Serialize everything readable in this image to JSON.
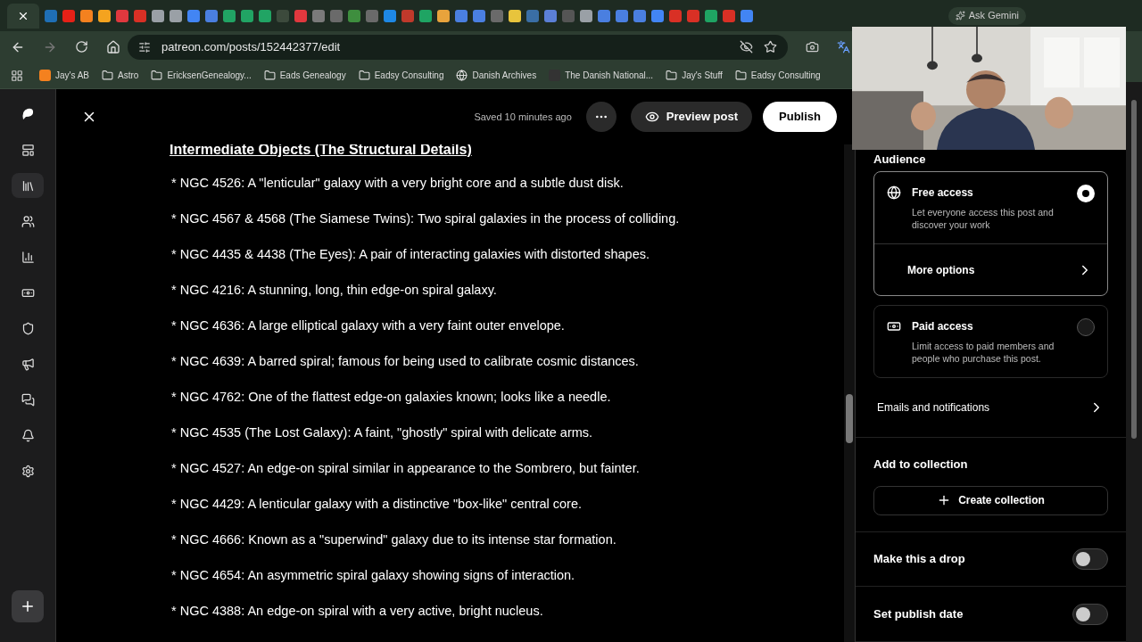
{
  "browser": {
    "tab_favicons": [
      {
        "color": "#1f6fb5"
      },
      {
        "color": "#e62117"
      },
      {
        "color": "#f4811f"
      },
      {
        "color": "#f4a31f"
      },
      {
        "color": "#e0383e"
      },
      {
        "color": "#d93025"
      },
      {
        "color": "#9aa0a6"
      },
      {
        "color": "#9aa0a6"
      },
      {
        "color": "#4285f4"
      },
      {
        "color": "#4a7fe0"
      },
      {
        "color": "#21a464"
      },
      {
        "color": "#21a464"
      },
      {
        "color": "#21a464"
      },
      {
        "color": "#3c4a3c"
      },
      {
        "color": "#e0383e"
      },
      {
        "color": "#7a7a7a"
      },
      {
        "color": "#6a6a6a"
      },
      {
        "color": "#3e8e3e"
      },
      {
        "color": "#6a6a6a"
      },
      {
        "color": "#1e88e5"
      },
      {
        "color": "#c0392b"
      },
      {
        "color": "#1fa463"
      },
      {
        "color": "#e8a33c"
      },
      {
        "color": "#4a7fe0"
      },
      {
        "color": "#4a7fe0"
      },
      {
        "color": "#6a6a6a"
      },
      {
        "color": "#e8c43c"
      },
      {
        "color": "#3a6ea5"
      },
      {
        "color": "#5b7fd6"
      },
      {
        "color": "#555555"
      },
      {
        "color": "#9aa0a6"
      },
      {
        "color": "#4a7fe0"
      },
      {
        "color": "#4a7fe0"
      },
      {
        "color": "#4a7fe0"
      },
      {
        "color": "#4285f4"
      },
      {
        "color": "#d93025"
      },
      {
        "color": "#d93025"
      },
      {
        "color": "#1fa463"
      },
      {
        "color": "#d93025"
      },
      {
        "color": "#4285f4"
      }
    ],
    "ask_label": "Ask Gemini",
    "url": "patreon.com/posts/152442377/edit",
    "bookmarks": [
      {
        "kind": "site",
        "label": "Jay's AB",
        "color": "#f4811f"
      },
      {
        "kind": "folder",
        "label": "Astro"
      },
      {
        "kind": "folder",
        "label": "EricksenGenealogy..."
      },
      {
        "kind": "folder",
        "label": "Eads Genealogy"
      },
      {
        "kind": "folder",
        "label": "Eadsy Consulting"
      },
      {
        "kind": "globe",
        "label": "Danish Archives"
      },
      {
        "kind": "site",
        "label": "The Danish National...",
        "color": "#333333"
      },
      {
        "kind": "folder",
        "label": "Jay's Stuff"
      },
      {
        "kind": "folder",
        "label": "Eadsy Consulting"
      }
    ]
  },
  "rail": {
    "items": [
      {
        "kind": "logo",
        "selected": false
      },
      {
        "kind": "layout",
        "selected": false
      },
      {
        "kind": "library",
        "selected": true
      },
      {
        "kind": "people",
        "selected": false
      },
      {
        "kind": "chart",
        "selected": false
      },
      {
        "kind": "money",
        "selected": false
      },
      {
        "kind": "shield",
        "selected": false
      },
      {
        "kind": "megaphone",
        "selected": false
      },
      {
        "kind": "chat",
        "selected": false
      },
      {
        "kind": "bell",
        "selected": false
      },
      {
        "kind": "gear",
        "selected": false
      }
    ]
  },
  "header": {
    "saved": "Saved 10 minutes ago",
    "preview": "Preview post",
    "publish": "Publish"
  },
  "editor": {
    "heading": "Intermediate Objects (The Structural Details)",
    "items": [
      "* NGC 4526: A \"lenticular\" galaxy with a very bright core and a subtle dust disk.",
      "* NGC 4567 & 4568 (The Siamese Twins): Two spiral galaxies in the process of colliding.",
      "* NGC 4435 & 4438 (The Eyes): A pair of interacting galaxies with distorted shapes.",
      "* NGC 4216: A stunning, long, thin edge-on spiral galaxy.",
      "* NGC 4636: A large elliptical galaxy with a very faint outer envelope.",
      "* NGC 4639: A barred spiral; famous for being used to calibrate cosmic distances.",
      "* NGC 4762: One of the flattest edge-on galaxies known; looks like a needle.",
      "* NGC 4535 (The Lost Galaxy): A faint, \"ghostly\" spiral with delicate arms.",
      "* NGC 4527: An edge-on spiral similar in appearance to the Sombrero, but fainter.",
      "* NGC 4429: A lenticular galaxy with a distinctive \"box-like\" central core.",
      "* NGC 4666: Known as a \"superwind\" galaxy due to its intense star formation.",
      "* NGC 4654: An asymmetric spiral galaxy showing signs of interaction.",
      "* NGC 4388: An edge-on spiral with a very active, bright nucleus."
    ]
  },
  "settings": {
    "audience_title": "Audience",
    "access_options": [
      {
        "kind": "globe",
        "title": "Free access",
        "description": "Let everyone access this post and discover your work",
        "selected": true
      },
      {
        "kind": "money",
        "title": "Paid access",
        "description": "Limit access to paid members and people who purchase this post.",
        "selected": false
      }
    ],
    "more_options": "More options",
    "emails": "Emails and notifications",
    "collection_title": "Add to collection",
    "create_collection": "Create collection",
    "toggles": [
      {
        "label": "Make this a drop",
        "on": false
      },
      {
        "label": "Set publish date",
        "on": false
      }
    ]
  }
}
